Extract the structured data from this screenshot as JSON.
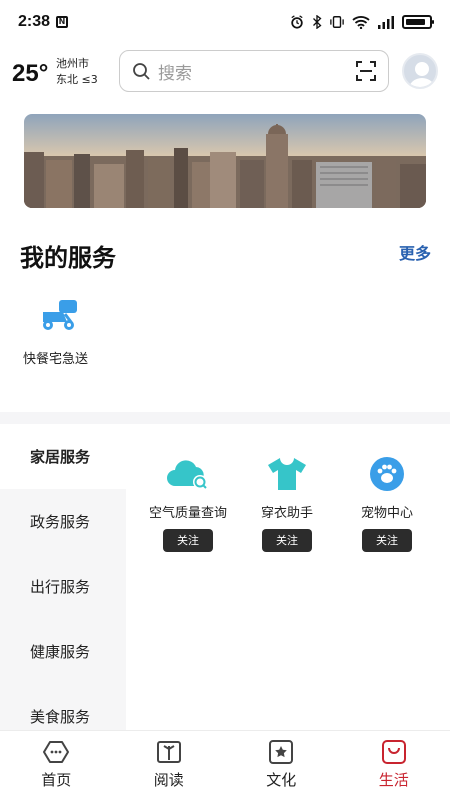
{
  "status_bar": {
    "time": "2:38",
    "left_icon_label": "N",
    "icons": [
      "alarm-icon",
      "bluetooth-icon",
      "vibrate-icon",
      "wifi-icon",
      "signal-icon",
      "battery-icon"
    ],
    "battery_level": 0.85
  },
  "header": {
    "temperature": "25°",
    "city": "池州市",
    "wind": "东北 ≤3",
    "search_placeholder": "搜索"
  },
  "my_services": {
    "title": "我的服务",
    "more_label": "更多",
    "items": [
      {
        "label": "快餐宅急送",
        "icon": "delivery-scooter-icon"
      }
    ]
  },
  "categories": [
    {
      "label": "家居服务",
      "active": true
    },
    {
      "label": "政务服务",
      "active": false
    },
    {
      "label": "出行服务",
      "active": false
    },
    {
      "label": "健康服务",
      "active": false
    },
    {
      "label": "美食服务",
      "active": false
    }
  ],
  "services": [
    {
      "label": "空气质量查询",
      "icon": "air-quality-cloud-icon",
      "button": "关注"
    },
    {
      "label": "穿衣助手",
      "icon": "tshirt-icon",
      "button": "关注"
    },
    {
      "label": "宠物中心",
      "icon": "paw-icon",
      "button": "关注"
    }
  ],
  "tabbar": {
    "tabs": [
      {
        "label": "首页",
        "icon": "home-icon",
        "active": false
      },
      {
        "label": "阅读",
        "icon": "book-icon",
        "active": false
      },
      {
        "label": "文化",
        "icon": "culture-star-icon",
        "active": false
      },
      {
        "label": "生活",
        "icon": "life-bag-icon",
        "active": true
      }
    ]
  },
  "colors": {
    "accent_red": "#c8242f",
    "link_blue": "#2a62b0",
    "icon_teal": "#36c5c9",
    "icon_blue": "#3a9ee8"
  }
}
